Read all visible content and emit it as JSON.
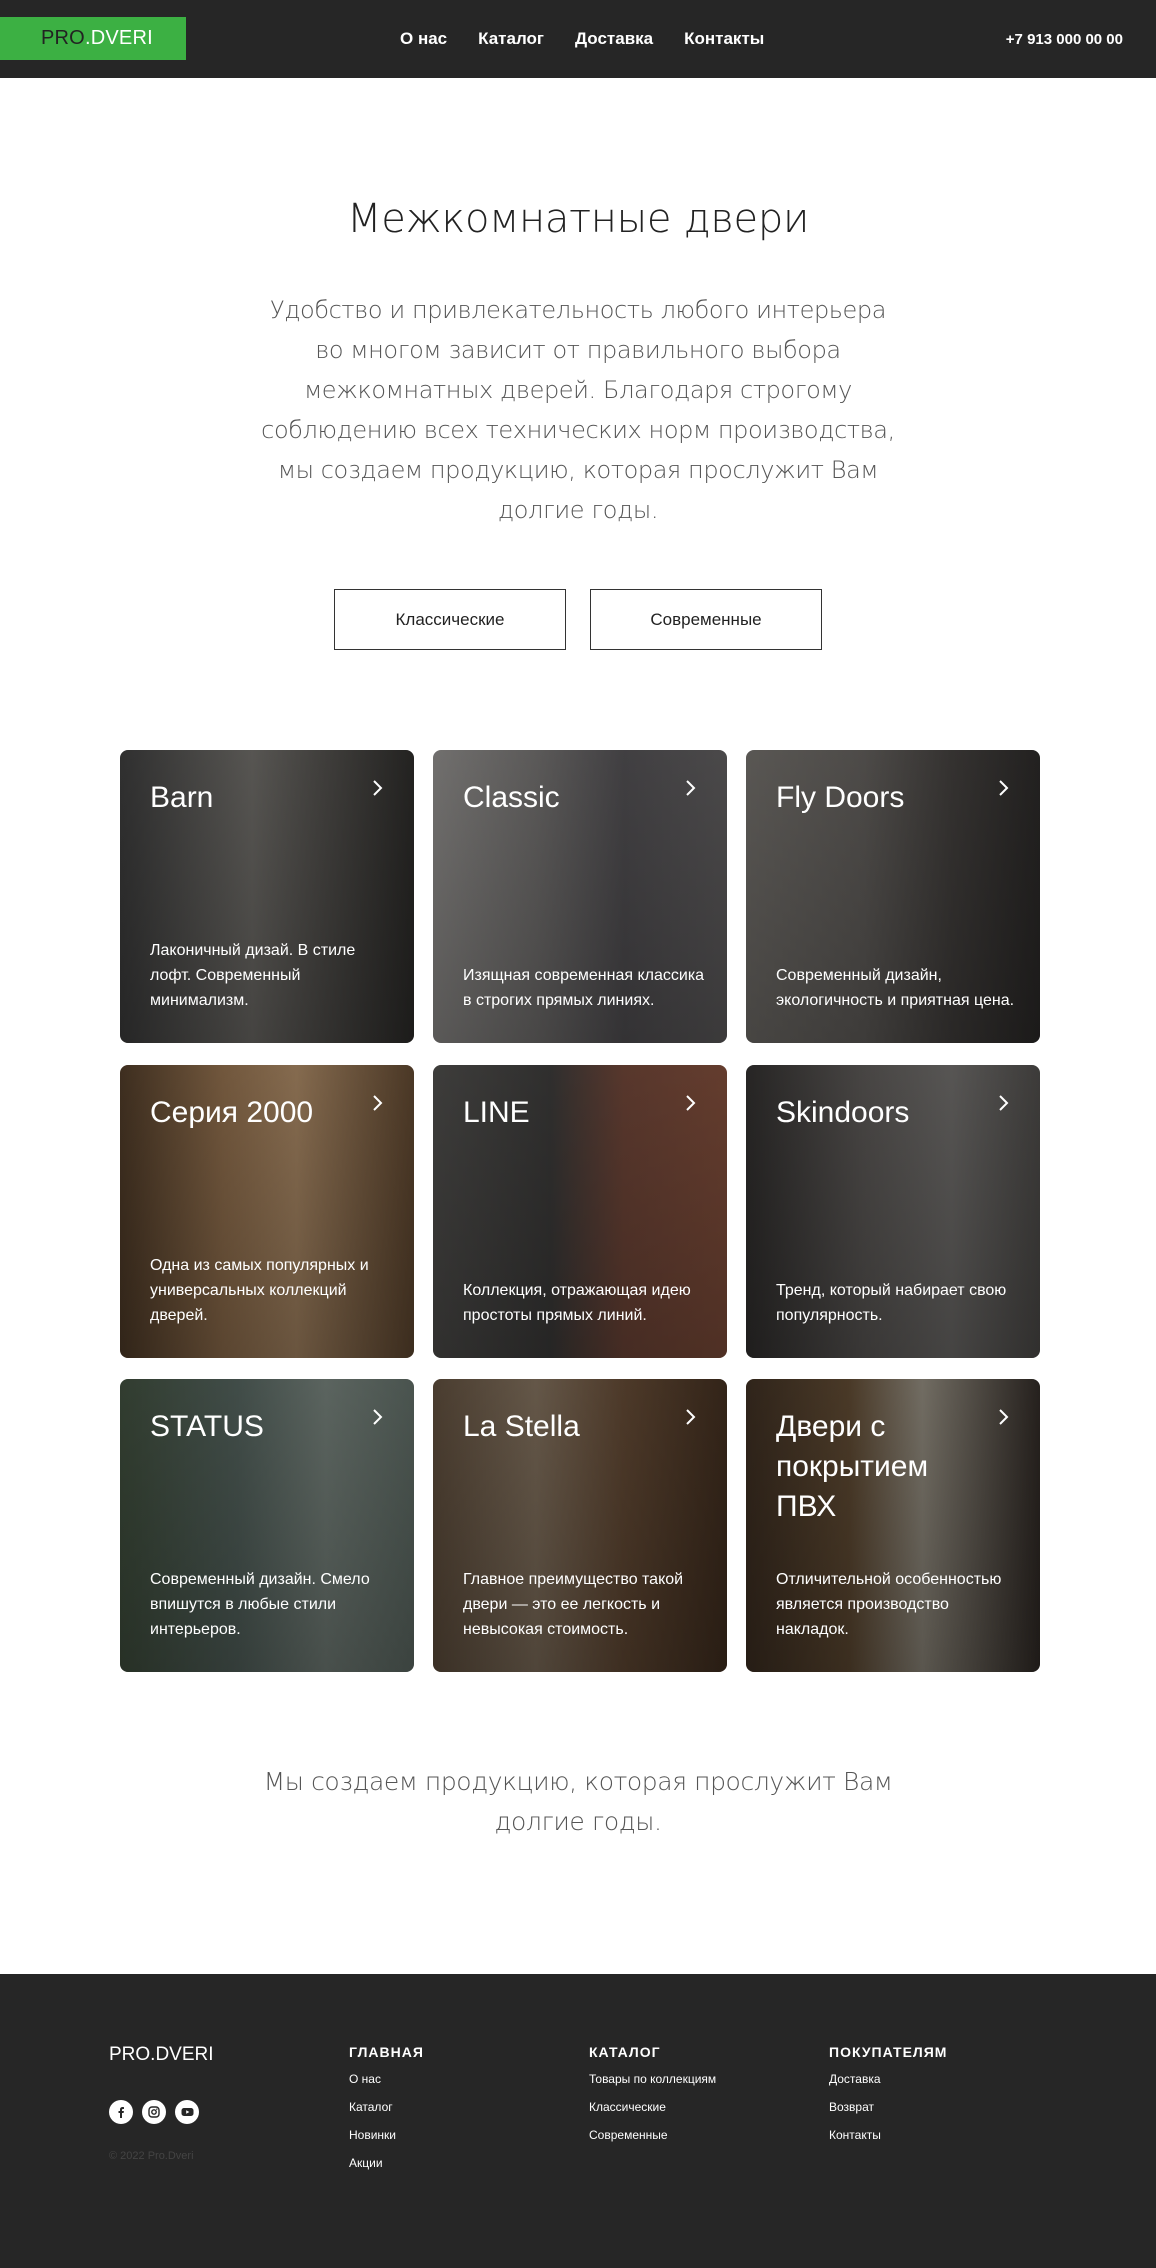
{
  "header": {
    "logo": {
      "part1": "PRO",
      "sep": ".",
      "part2": "DVERI"
    },
    "nav": [
      "О нас",
      "Каталог",
      "Доставка",
      "Контакты"
    ],
    "phone": "+7 913 000 00 00"
  },
  "intro": {
    "title": "Межкомнатные двери",
    "lead": "Удобство и привлекательность любого интерьера во многом зависит от правильного выбора межкомнатных дверей. Благодаря строгому соблюдению всех технических норм производства, мы создаем продукцию, которая прослужит Вам долгие годы.",
    "buttons": [
      "Классические",
      "Современные"
    ]
  },
  "cards": [
    {
      "name": "Barn",
      "desc": "Лаконичный дизай. В стиле лофт. Современный минимализм."
    },
    {
      "name": "Classic",
      "desc": "Изящная современная классика в строгих прямых линиях."
    },
    {
      "name": "Fly Doors",
      "desc": "Современный дизайн, экологичность и приятная цена."
    },
    {
      "name": "Серия 2000",
      "desc": "Одна из самых популярных и универсальных коллекций дверей."
    },
    {
      "name": "LINE",
      "desc": "Коллекция, отражающая идею простоты прямых линий."
    },
    {
      "name": "Skindoors",
      "desc": "Тренд, который набирает свою популярность."
    },
    {
      "name": "STATUS",
      "desc": "Современный дизайн. Смело впишутся в любые стили интерьеров."
    },
    {
      "name": "La Stella",
      "desc": "Главное преимущество такой двери — это ее легкость и невысокая стоимость."
    },
    {
      "name": "Двери с покрытием ПВХ",
      "desc": "Отличительной особенностью является производство накладок."
    }
  ],
  "outro": "Мы создаем продукцию, которая прослужит Вам долгие годы.",
  "footer": {
    "logo": "PRO.DVERI",
    "copyright": "© 2022 Pro.Dveri",
    "socials": [
      "facebook-icon",
      "instagram-icon",
      "youtube-icon"
    ],
    "columns": [
      {
        "title": "ГЛАВНАЯ",
        "links": [
          "О нас",
          "Каталог",
          "Новинки",
          "Акции"
        ]
      },
      {
        "title": "КАТАЛОГ",
        "links": [
          "Товары по коллекциям",
          "Классические",
          "Современные"
        ]
      },
      {
        "title": "ПОКУПАТЕЛЯМ",
        "links": [
          "Доставка",
          "Возврат",
          "Контакты"
        ]
      }
    ]
  },
  "colors": {
    "accent": "#3cb043",
    "dark": "#262626"
  }
}
